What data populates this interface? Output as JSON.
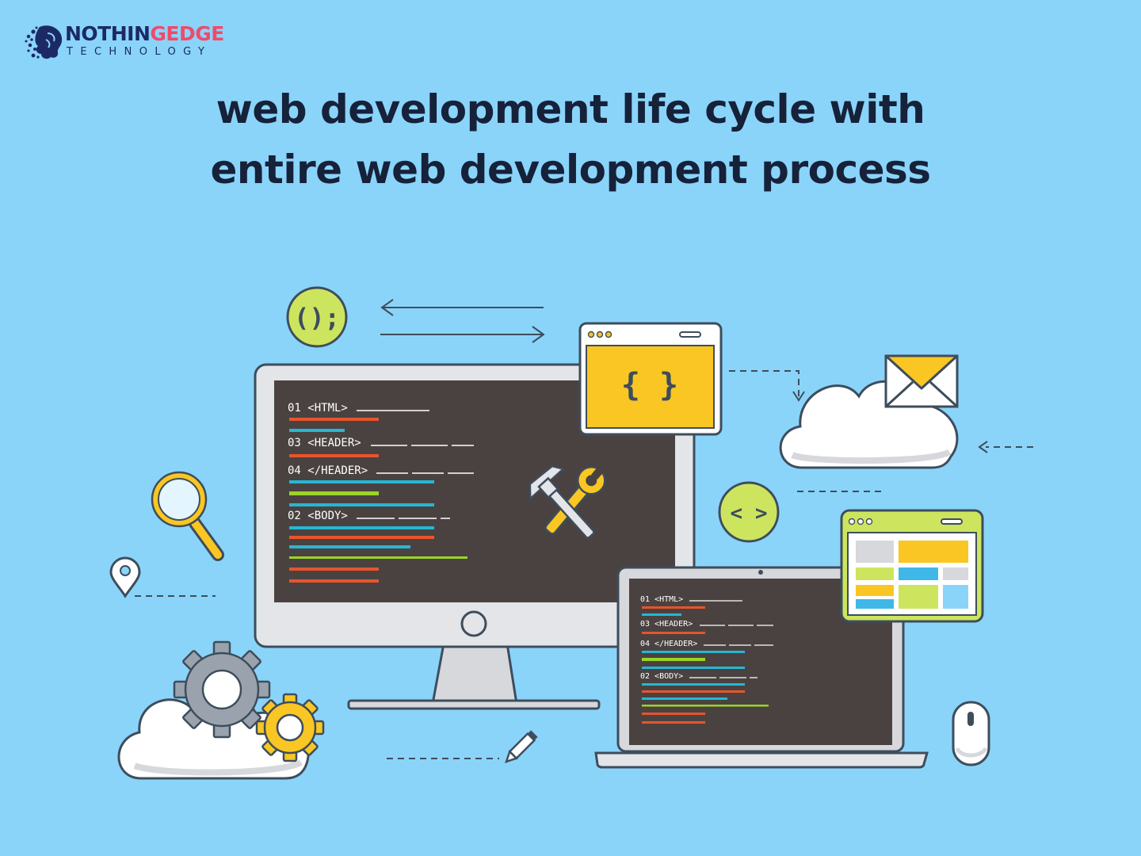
{
  "brand": {
    "name_part1": "NOTHIN",
    "name_part2": "GEDGE",
    "tagline": "TECHNOLOGY",
    "colors": {
      "primary": "#1b2a66",
      "accent": "#ef4b6a"
    }
  },
  "headline": {
    "line1": "web development life cycle with",
    "line2": "entire web development process"
  },
  "illustration": {
    "function_badge": "();",
    "code_badge": "< >",
    "braces_window": "{ }",
    "monitor_code": [
      "01 <HTML>",
      "03 <HEADER>",
      "04 </HEADER>",
      "02 <BODY>"
    ],
    "laptop_code": [
      "01 <HTML>",
      "03 <HEADER>",
      "04 </HEADER>",
      "02 <BODY>"
    ],
    "icons": [
      "magnifier-icon",
      "location-pin-icon",
      "gears-icon",
      "cloud-icon",
      "envelope-icon",
      "mouse-icon",
      "pencil-icon",
      "hammer-wrench-icon"
    ]
  },
  "colors": {
    "background": "#8ad4fa",
    "outline": "#3e4d5c",
    "screen": "#4a4240",
    "yellow": "#f9c623",
    "lime": "#cde55e",
    "code_red": "#e8542c",
    "code_cyan": "#27b6d3",
    "code_green": "#9bd427"
  }
}
